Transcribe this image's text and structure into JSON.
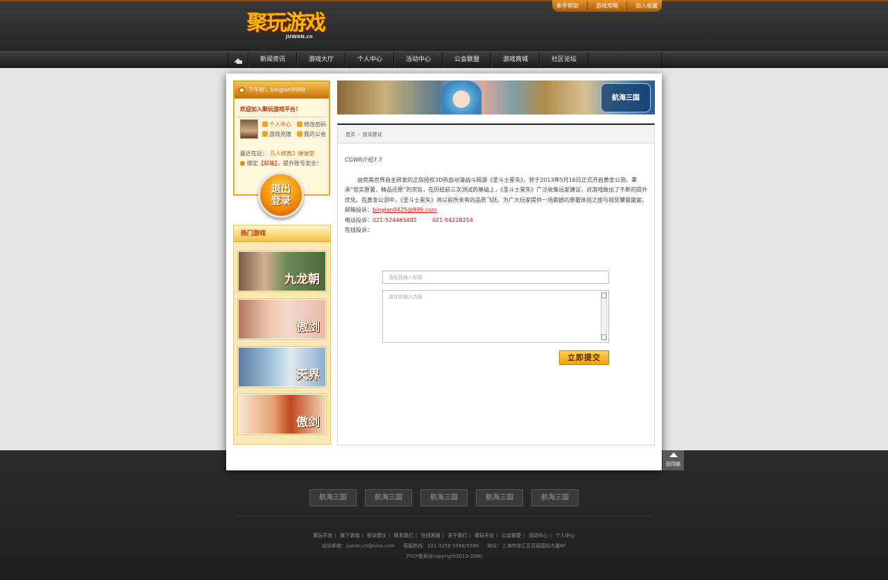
{
  "logo": {
    "text": "聚玩游戏",
    "domain": "JUWAN.cn"
  },
  "toplinks": [
    "新手帮助",
    "游戏攻略",
    "加入收藏"
  ],
  "nav": {
    "home_icon": "home-icon",
    "items": [
      "新闻资讯",
      "游戏大厅",
      "个人中心",
      "活动中心",
      "公会联盟",
      "游戏商城",
      "社区论坛"
    ]
  },
  "user": {
    "greeting": "下午好，binglan9988",
    "welcome": "欢迎加入聚玩游戏平台！",
    "links": [
      "个人中心",
      "修改密码",
      "游戏充值",
      "我的公会"
    ],
    "recent_label": "最近在玩：",
    "recent_games": [
      "凡人修真2",
      "弹弹堂"
    ],
    "bind_pre": "绑定",
    "bind_mail": "【邮箱】",
    "bind_post": "，提升账号安全！",
    "logout_line1": "退出",
    "logout_line2": "登录"
  },
  "hot": {
    "title": "热门游戏",
    "games": [
      "九龙朝",
      "傲剑",
      "天界",
      "傲剑"
    ]
  },
  "banner": {
    "logo": "航海三国"
  },
  "crumb": {
    "home": "首页",
    "current": "投诉建议"
  },
  "article": {
    "title": "CGWR介绍7.7",
    "body": "由完美世界自主研发的正版授权3D热血动漫战斗网游《圣斗士星矢》，将于2013年5月16日正式开启黄金公测。秉承“忠实原著，精品还原”的宗旨，在历经前三次测试的基础上，《圣斗士星矢》广泛收集玩家建议，对游戏做出了不断的提升优化。在黄金公测中，《圣斗士星矢》将以前所未有的品质飞跃，为广大玩家提供一场震撼的原著体验之旅与视觉饕餮盛宴。",
    "email_label": "邮箱投诉：",
    "email": "binglan0425@999.com",
    "phone_label": "电话投诉：",
    "phone1": "021-524465482",
    "phone2": "021-54228214",
    "online_label": "在线投诉："
  },
  "form": {
    "title_placeholder": "请在此输入标题",
    "content_placeholder": "请在此输入内容",
    "submit": "立即提交"
  },
  "backtop": "回顶部",
  "footer": {
    "partners": [
      "航海三国",
      "航海三国",
      "航海三国",
      "航海三国",
      "航海三国"
    ],
    "links": [
      "聚玩平台",
      "旗下游戏",
      "投诉建议",
      "联系我们",
      "在线客服",
      "关于我们",
      "聚玩平台",
      "公会联盟",
      "活动中心",
      "个人中心"
    ],
    "email": "投诉邮箱：juwan.cn@sina.com",
    "hotline": "客服热线：021-2258 5568/5589",
    "address": "地址：上海市徐汇区百丽国际大厦6F",
    "copyright": "沪ICP备案@copyright2013-2080"
  }
}
